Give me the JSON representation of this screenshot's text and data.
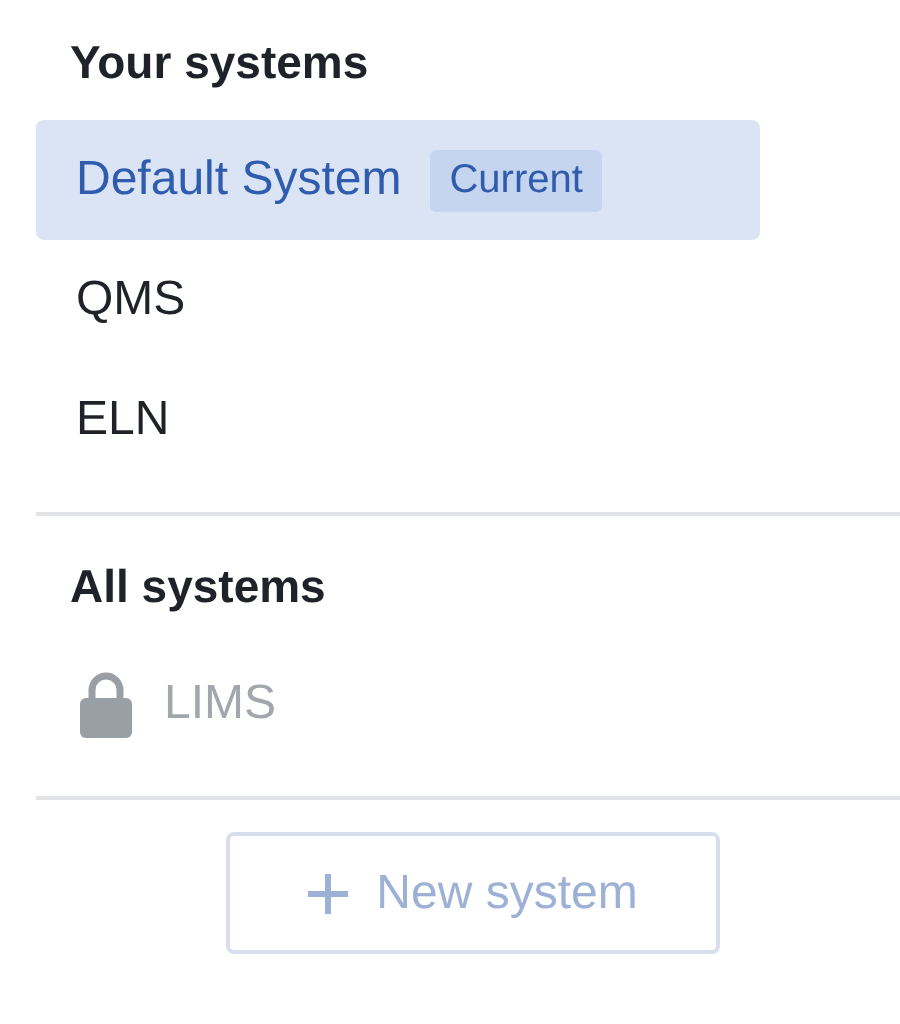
{
  "your_systems": {
    "heading": "Your systems",
    "items": [
      {
        "name": "Default System",
        "badge": "Current",
        "selected": true
      },
      {
        "name": "QMS",
        "selected": false
      },
      {
        "name": "ELN",
        "selected": false
      }
    ]
  },
  "all_systems": {
    "heading": "All systems",
    "items": [
      {
        "name": "LIMS",
        "locked": true
      }
    ]
  },
  "new_button": {
    "label": "New system",
    "disabled": true
  }
}
